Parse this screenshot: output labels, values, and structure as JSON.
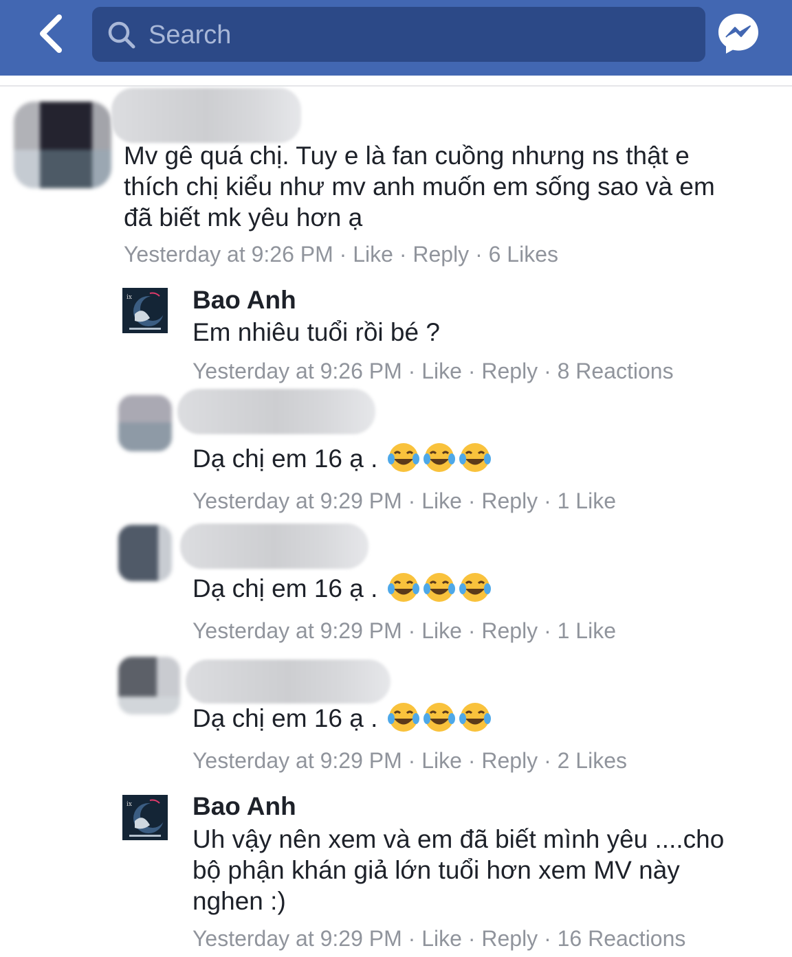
{
  "search": {
    "placeholder": "Search"
  },
  "thread": {
    "parent": {
      "text_lines": [
        "Mv gê quá chị. Tuy e là fan cuồng nhưng ns thật e",
        "thích chị kiểu như mv anh muốn em sống sao và em",
        "đã biết mk yêu hơn ạ"
      ],
      "time": "Yesterday at 9:26 PM",
      "like": "Like",
      "reply": "Reply",
      "count": "6 Likes"
    },
    "replies": [
      {
        "author": "Bao Anh",
        "text_lines": [
          "Em nhiêu tuổi rồi bé ?"
        ],
        "time": "Yesterday at 9:26 PM",
        "like": "Like",
        "reply": "Reply",
        "count": "8 Reactions"
      },
      {
        "text": "Dạ chị em 16 ạ .",
        "emoji": "tears-of-joy-emoji",
        "time": "Yesterday at 9:29 PM",
        "like": "Like",
        "reply": "Reply",
        "count": "1 Like"
      },
      {
        "text": "Dạ chị em 16 ạ .",
        "emoji": "tears-of-joy-emoji",
        "time": "Yesterday at 9:29 PM",
        "like": "Like",
        "reply": "Reply",
        "count": "1 Like"
      },
      {
        "text": "Dạ chị em 16 ạ .",
        "emoji": "tears-of-joy-emoji",
        "time": "Yesterday at 9:29 PM",
        "like": "Like",
        "reply": "Reply",
        "count": "2 Likes"
      },
      {
        "author": "Bao Anh",
        "text_lines": [
          "Uh vậy nên xem và em đã biết mình yêu ....cho",
          "bộ phận khán giả lớn tuổi hơn xem MV này",
          "nghen :)"
        ],
        "time": "Yesterday at 9:29 PM",
        "like": "Like",
        "reply": "Reply",
        "count": "16 Reactions"
      }
    ]
  },
  "icons": {
    "back": "chevron-left-icon",
    "search": "search-icon",
    "messenger": "messenger-icon"
  },
  "colors": {
    "header": "#4267b2",
    "search_bg": "#2c4987",
    "meta_text": "#90949c",
    "body_text": "#1d2129"
  }
}
